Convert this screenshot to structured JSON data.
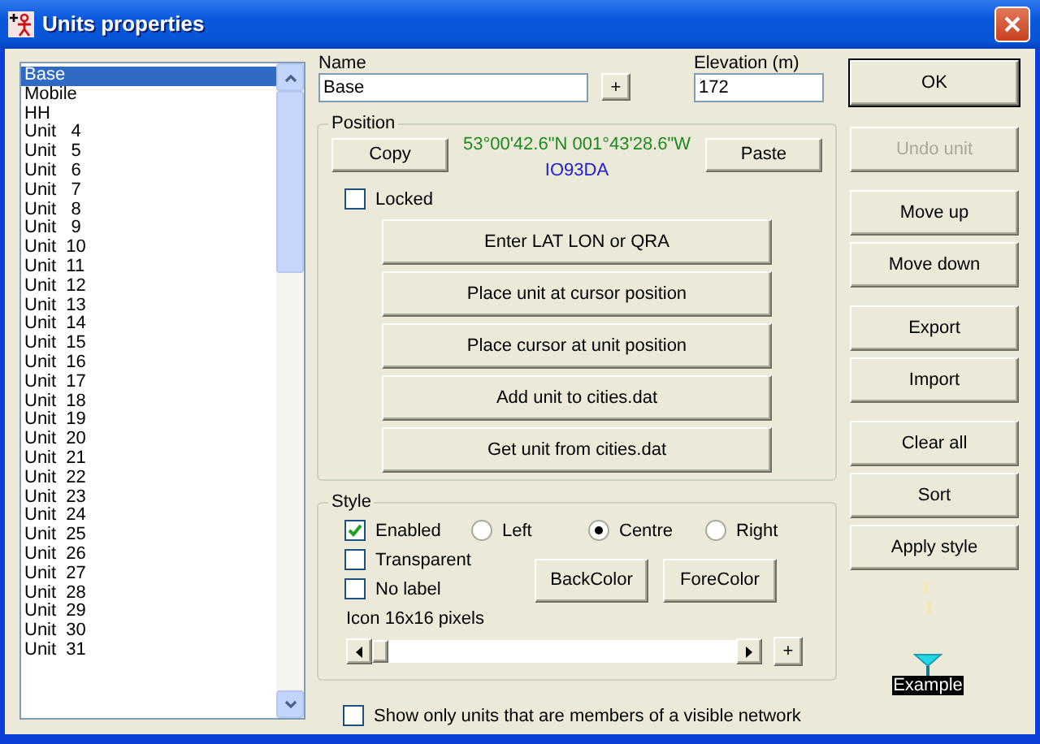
{
  "window": {
    "title": "Units properties"
  },
  "units": [
    {
      "label": "Base",
      "selected": true
    },
    {
      "label": "Mobile",
      "selected": false
    },
    {
      "label": "HH",
      "selected": false
    },
    {
      "label": "Unit   4",
      "selected": false
    },
    {
      "label": "Unit   5",
      "selected": false
    },
    {
      "label": "Unit   6",
      "selected": false
    },
    {
      "label": "Unit   7",
      "selected": false
    },
    {
      "label": "Unit   8",
      "selected": false
    },
    {
      "label": "Unit   9",
      "selected": false
    },
    {
      "label": "Unit  10",
      "selected": false
    },
    {
      "label": "Unit  11",
      "selected": false
    },
    {
      "label": "Unit  12",
      "selected": false
    },
    {
      "label": "Unit  13",
      "selected": false
    },
    {
      "label": "Unit  14",
      "selected": false
    },
    {
      "label": "Unit  15",
      "selected": false
    },
    {
      "label": "Unit  16",
      "selected": false
    },
    {
      "label": "Unit  17",
      "selected": false
    },
    {
      "label": "Unit  18",
      "selected": false
    },
    {
      "label": "Unit  19",
      "selected": false
    },
    {
      "label": "Unit  20",
      "selected": false
    },
    {
      "label": "Unit  21",
      "selected": false
    },
    {
      "label": "Unit  22",
      "selected": false
    },
    {
      "label": "Unit  23",
      "selected": false
    },
    {
      "label": "Unit  24",
      "selected": false
    },
    {
      "label": "Unit  25",
      "selected": false
    },
    {
      "label": "Unit  26",
      "selected": false
    },
    {
      "label": "Unit  27",
      "selected": false
    },
    {
      "label": "Unit  28",
      "selected": false
    },
    {
      "label": "Unit  29",
      "selected": false
    },
    {
      "label": "Unit  30",
      "selected": false
    },
    {
      "label": "Unit  31",
      "selected": false
    }
  ],
  "name": {
    "label": "Name",
    "value": "Base",
    "add_button": "+"
  },
  "elevation": {
    "label": "Elevation (m)",
    "value": "172"
  },
  "position": {
    "title": "Position",
    "copy_button": "Copy",
    "coordinates": "53°00'42.6\"N 001°43'28.6\"W",
    "locator": "IO93DA",
    "paste_button": "Paste",
    "locked": {
      "label": "Locked",
      "checked": false
    },
    "actions": [
      "Enter LAT LON or QRA",
      "Place unit at cursor position",
      "Place cursor at unit position",
      "Add unit to cities.dat",
      "Get unit from cities.dat"
    ]
  },
  "style": {
    "title": "Style",
    "checkboxes": [
      {
        "label": "Enabled",
        "checked": true
      },
      {
        "label": "Transparent",
        "checked": false
      },
      {
        "label": "No label",
        "checked": false
      }
    ],
    "alignment": [
      {
        "label": "Left",
        "selected": false
      },
      {
        "label": "Centre",
        "selected": true
      },
      {
        "label": "Right",
        "selected": false
      }
    ],
    "back_color_button": "BackColor",
    "fore_color_button": "ForeColor",
    "icon_size_label": "Icon 16x16 pixels",
    "icon_size": {
      "level": 0
    },
    "icon_add_button": "+"
  },
  "visible_network_only": {
    "label": "Show only units that are members of a visible network",
    "checked": false
  },
  "button_groups": [
    [
      {
        "label": "OK",
        "default": true,
        "disabled": false
      }
    ],
    [
      {
        "label": "Undo unit",
        "default": false,
        "disabled": true
      }
    ],
    [
      {
        "label": "Move up",
        "default": false,
        "disabled": false
      },
      {
        "label": "Move down",
        "default": false,
        "disabled": false
      }
    ],
    [
      {
        "label": "Export",
        "default": false,
        "disabled": false
      },
      {
        "label": "Import",
        "default": false,
        "disabled": false
      }
    ],
    [
      {
        "label": "Clear all",
        "default": false,
        "disabled": false
      },
      {
        "label": "Sort",
        "default": false,
        "disabled": false
      },
      {
        "label": "Apply style",
        "default": false,
        "disabled": false
      }
    ]
  ],
  "example": {
    "label": "Example"
  }
}
